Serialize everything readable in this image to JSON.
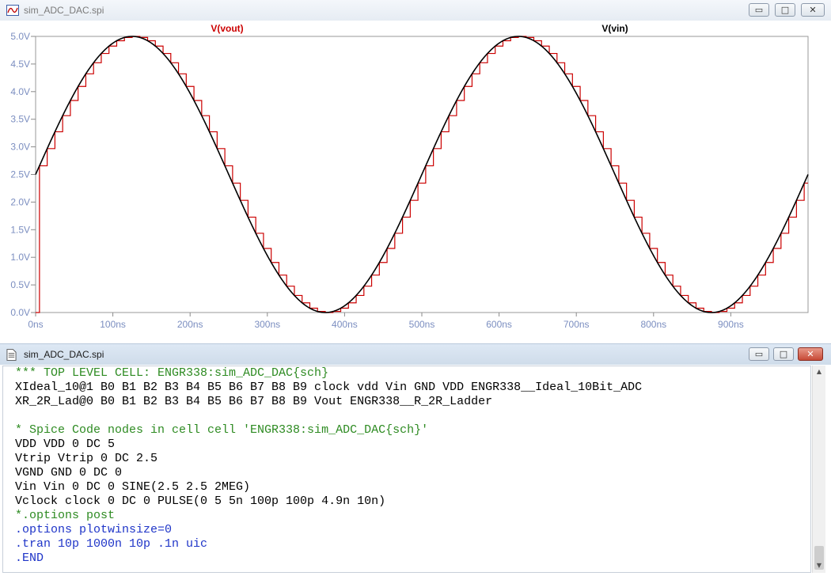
{
  "plot_window": {
    "title": "sim_ADC_DAC.spi",
    "buttons": {
      "minimize": "▭",
      "maximize": "□",
      "close": "✕"
    }
  },
  "text_window": {
    "title": "sim_ADC_DAC.spi",
    "buttons": {
      "minimize": "▭",
      "maximize": "□",
      "close": "✕"
    }
  },
  "colors": {
    "vout": "#cc0000",
    "vin": "#000000",
    "comment": "#2e8b22",
    "directive": "#1f35c8",
    "code": "#000000"
  },
  "chart_data": {
    "type": "line",
    "xlim": [
      0,
      1000
    ],
    "ylim": [
      0,
      5
    ],
    "x_unit": "ns",
    "x_ticks": [
      0,
      100,
      200,
      300,
      400,
      500,
      600,
      700,
      800,
      900
    ],
    "x_tick_labels": [
      "0ns",
      "100ns",
      "200ns",
      "300ns",
      "400ns",
      "500ns",
      "600ns",
      "700ns",
      "800ns",
      "900ns"
    ],
    "y_ticks": [
      0,
      0.5,
      1,
      1.5,
      2,
      2.5,
      3,
      3.5,
      4,
      4.5,
      5
    ],
    "y_tick_labels": [
      "0.0V",
      "0.5V",
      "1.0V",
      "1.5V",
      "2.0V",
      "2.5V",
      "3.0V",
      "3.5V",
      "4.0V",
      "4.5V",
      "5.0V"
    ],
    "series": [
      {
        "name": "V(vout)",
        "shape": "step",
        "sample_period_ns": 10,
        "first_sample_ns": 5,
        "offset": 2.5,
        "amplitude": 2.5,
        "freq_mhz": 2
      },
      {
        "name": "V(vin)",
        "shape": "sine",
        "offset": 2.5,
        "amplitude": 2.5,
        "freq_mhz": 2
      }
    ],
    "legend": [
      "V(vout)",
      "V(vin)"
    ],
    "grid": false
  },
  "code_lines": [
    {
      "text": "*** TOP LEVEL CELL: ENGR338:sim_ADC_DAC{sch}",
      "kind": "comment"
    },
    {
      "text": "XIdeal_10@1 B0 B1 B2 B3 B4 B5 B6 B7 B8 B9 clock vdd Vin GND VDD ENGR338__Ideal_10Bit_ADC",
      "kind": "code"
    },
    {
      "text": "XR_2R_Lad@0 B0 B1 B2 B3 B4 B5 B6 B7 B8 B9 Vout ENGR338__R_2R_Ladder",
      "kind": "code"
    },
    {
      "text": "",
      "kind": "code"
    },
    {
      "text": "* Spice Code nodes in cell cell 'ENGR338:sim_ADC_DAC{sch}'",
      "kind": "comment"
    },
    {
      "text": "VDD VDD 0 DC 5",
      "kind": "code"
    },
    {
      "text": "Vtrip Vtrip 0 DC 2.5",
      "kind": "code"
    },
    {
      "text": "VGND GND 0 DC 0",
      "kind": "code"
    },
    {
      "text": "Vin Vin 0 DC 0 SINE(2.5 2.5 2MEG)",
      "kind": "code"
    },
    {
      "text": "Vclock clock 0 DC 0 PULSE(0 5 5n 100p 100p 4.9n 10n)",
      "kind": "code"
    },
    {
      "text": "*.options post",
      "kind": "comment"
    },
    {
      "text": ".options plotwinsize=0",
      "kind": "directive"
    },
    {
      "text": ".tran 10p 1000n 10p .1n uic",
      "kind": "directive"
    },
    {
      "text": ".END",
      "kind": "directive"
    }
  ]
}
